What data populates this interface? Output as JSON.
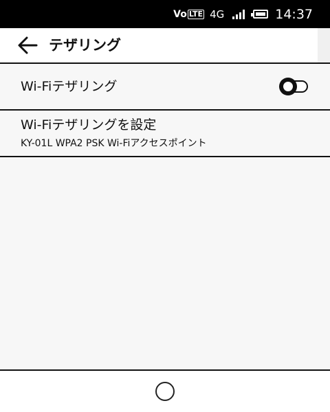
{
  "status_bar": {
    "volte_prefix": "Vo",
    "volte_box": "LTE",
    "network": "4G",
    "time": "14:37"
  },
  "app_bar": {
    "title": "テザリング",
    "back_icon": "arrow-left-icon"
  },
  "settings": {
    "wifi_tethering": {
      "label": "Wi-Fiテザリング",
      "enabled": false
    },
    "wifi_tethering_config": {
      "title": "Wi-Fiテザリングを設定",
      "summary": "KY-01L WPA2 PSK Wi-Fiアクセスポイント"
    }
  },
  "nav_bar": {
    "home_icon": "home-circle-icon"
  },
  "colors": {
    "status_bar_bg": "#000000",
    "content_bg": "#f7f7f7",
    "text": "#111111"
  }
}
